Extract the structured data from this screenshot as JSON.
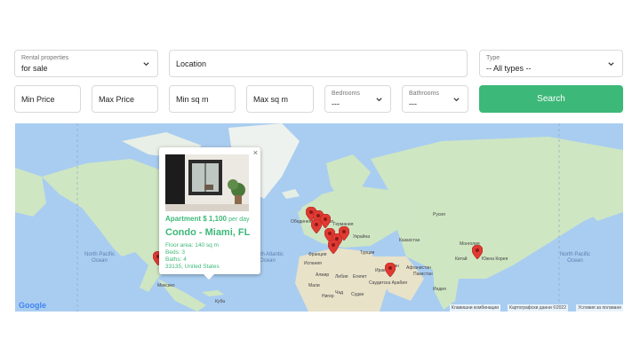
{
  "filters": {
    "rental": {
      "label": "Rental properties",
      "value": "for sale"
    },
    "location": {
      "placeholder": "Location"
    },
    "type": {
      "label": "Type",
      "value": "-- All types --"
    },
    "min_price": {
      "placeholder": "Min Price"
    },
    "max_price": {
      "placeholder": "Max Price"
    },
    "min_sqm": {
      "placeholder": "Min sq m"
    },
    "max_sqm": {
      "placeholder": "Max sq m"
    },
    "bedrooms": {
      "label": "Bedrooms",
      "value": "---"
    },
    "bathrooms": {
      "label": "Bathrooms",
      "value": "---"
    },
    "search_label": "Search"
  },
  "map": {
    "ocean_labels": [
      "North Pacific Ocean",
      "North Atlantic Ocean",
      "North Pacific Ocean"
    ],
    "place_labels": [
      "Казахстан",
      "Монголия",
      "Китай",
      "Пакистан",
      "Индия",
      "Египет",
      "Алжир",
      "Судан",
      "Либия",
      "Германия",
      "Украйна",
      "Турция",
      "Иран",
      "Саудитска Арабия",
      "Южна Корея",
      "Франция",
      "Испания",
      "Чад",
      "Нигер",
      "Мали",
      "Обединено кралство",
      "Русия",
      "Афганистан",
      "Ирак",
      "Мексико",
      "Куба"
    ],
    "attribution": [
      "Клавишни комбинации",
      "Картографски данни ©2022",
      "Условия за ползване"
    ],
    "logo": "Google"
  },
  "popup": {
    "close": "×",
    "price": "Apartment $ 1,100",
    "price_unit": "per day",
    "title": "Condo - Miami, FL",
    "floor_area": "Floor area: 140 sq m",
    "beds": "Beds: 3",
    "baths": "Baths: 4",
    "address": "33135, United States"
  },
  "colors": {
    "accent": "#3cb878",
    "marker": "#e03a32",
    "water": "#a9cdf0",
    "land": "#cfe6c3"
  }
}
